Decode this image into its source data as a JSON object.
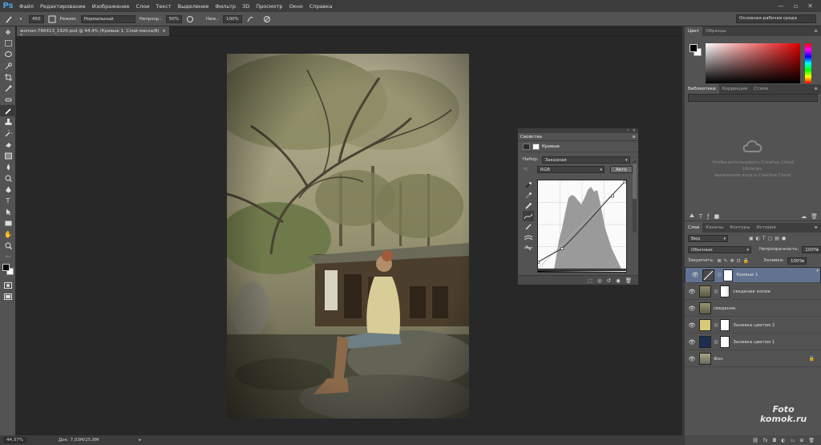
{
  "app": {
    "logo": "Ps"
  },
  "menubar": {
    "items": [
      "Файл",
      "Редактирование",
      "Изображение",
      "Слои",
      "Текст",
      "Выделение",
      "Фильтр",
      "3D",
      "Просмотр",
      "Окно",
      "Справка"
    ],
    "window_controls": [
      "—",
      "▫",
      "✕"
    ]
  },
  "options": {
    "brush_size": "450",
    "mode_label": "Режим:",
    "mode_value": "Нормальный",
    "opacity_label": "Непрозр.:",
    "opacity_value": "50%",
    "pressure_label": "Наж.:",
    "pressure_value": "100%",
    "workspace": "Основная рабочая среда"
  },
  "document": {
    "tab_title": "woman-766413_1920.psd @ 44,4% (Кривые 1, Слой-маска/8) *",
    "close": "×"
  },
  "status": {
    "zoom": "44,37%",
    "doc_info": "Док: 7,03M/25,8M",
    "arrow": "▸"
  },
  "properties": {
    "panel_tab": "Свойства",
    "type_label": "Кривые",
    "preset_label": "Набор:",
    "preset_value": "Заказная",
    "channel_value": "RGB",
    "auto_button": "Авто",
    "collapse": "«",
    "close": "✕"
  },
  "color_panel": {
    "tabs": [
      "Цвет",
      "Образцы"
    ],
    "foreground": "#000000",
    "background": "#ffffff"
  },
  "libraries_panel": {
    "tabs": [
      "Библиотеки",
      "Коррекция",
      "Стили"
    ],
    "cc_line1": "Чтобы использовать Creative Cloud",
    "cc_line2": "Libraries,",
    "cc_line3": "выполните вход в Creative Cloud"
  },
  "layers_panel": {
    "tabs": [
      "Слои",
      "Каналы",
      "Контуры",
      "История"
    ],
    "kind_filter": "Вид",
    "blend_mode": "Обычные",
    "opacity_label": "Непрозрачность:",
    "opacity_value": "100%",
    "lock_label": "Закрепить:",
    "fill_label": "Заливка:",
    "fill_value": "100%",
    "layers": [
      {
        "name": "Кривые 1",
        "selected": true
      },
      {
        "name": "сведение копия",
        "selected": false
      },
      {
        "name": "сведение",
        "selected": false
      },
      {
        "name": "Заливка цветом 2",
        "selected": false
      },
      {
        "name": "Заливка цветом 1",
        "selected": false
      },
      {
        "name": "Фон",
        "selected": false
      }
    ],
    "fill1_color": "#1c2e52",
    "fill2_color": "#d8c878"
  },
  "watermark": {
    "line1": "Foto",
    "line2": "komok.ru"
  }
}
